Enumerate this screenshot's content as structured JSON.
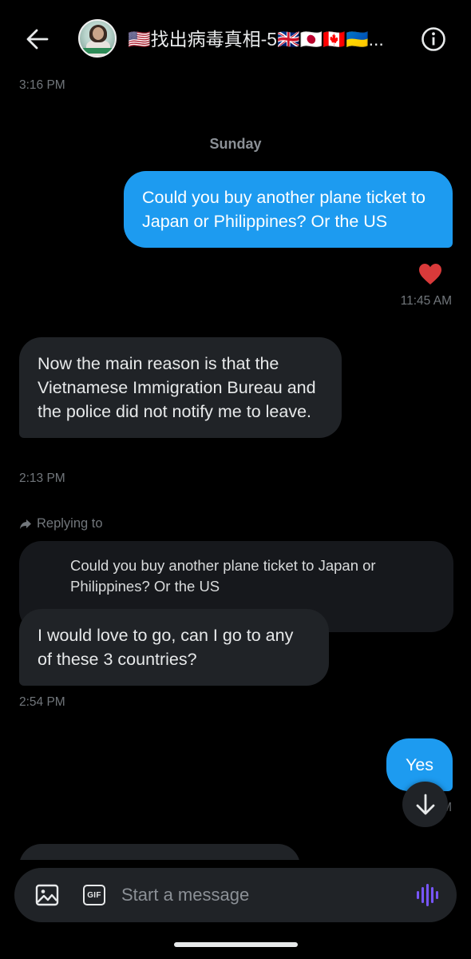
{
  "header": {
    "title": "🇺🇸找出病毒真相-5🇬🇧🇯🇵🇨🇦🇺🇦...",
    "back_icon": "arrow-left-icon",
    "info_icon": "info-circle-icon"
  },
  "messages": {
    "top_timestamp": "3:16 PM",
    "day_separator": "Sunday",
    "items": [
      {
        "direction": "outgoing",
        "text": "Could you buy another plane ticket to Japan or Philippines? Or the US"
      },
      {
        "direction": "incoming",
        "text": "Now the main reason is that the Vietnamese Immigration Bureau and the police did not notify me to leave."
      },
      {
        "direction": "incoming",
        "text": "I would love to go, can I go to any of these 3 countries?"
      },
      {
        "direction": "outgoing",
        "text": "Yes"
      }
    ],
    "timestamps": [
      "11:45 AM",
      "2:13 PM",
      "2:54 PM",
      "M"
    ],
    "reaction": "heart-icon",
    "reply": {
      "label": "Replying to",
      "quoted_text": "Could you buy another plane ticket to Japan or Philippines? Or the US"
    }
  },
  "composer": {
    "placeholder": "Start a message",
    "gif_label": "GIF",
    "media_icon": "image-icon",
    "voice_icon": "audio-waveform-icon"
  },
  "colors": {
    "background": "#000000",
    "outgoing_bubble": "#1d9bf0",
    "incoming_bubble": "#202327",
    "muted_text": "#71767b",
    "accent_voice": "#7856ff"
  }
}
